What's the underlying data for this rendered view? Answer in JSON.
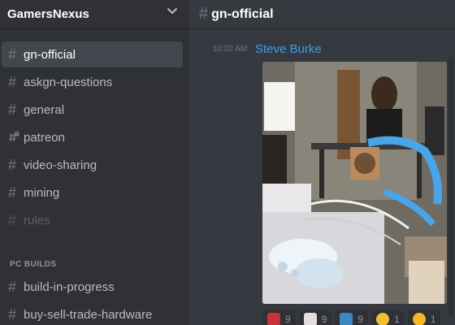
{
  "server": {
    "name": "GamersNexus"
  },
  "channels": [
    {
      "label": "gn-official",
      "state": "active",
      "icon": "hash"
    },
    {
      "label": "askgn-questions",
      "state": "normal",
      "icon": "hash"
    },
    {
      "label": "general",
      "state": "normal",
      "icon": "hash"
    },
    {
      "label": "patreon",
      "state": "normal",
      "icon": "locked-hash"
    },
    {
      "label": "video-sharing",
      "state": "normal",
      "icon": "hash"
    },
    {
      "label": "mining",
      "state": "normal",
      "icon": "hash"
    },
    {
      "label": "rules",
      "state": "muted",
      "icon": "hash"
    }
  ],
  "category": {
    "label": "PC BUILDS"
  },
  "category_channels": [
    {
      "label": "build-in-progress",
      "icon": "hash"
    },
    {
      "label": "buy-sell-trade-hardware",
      "icon": "hash"
    }
  ],
  "main": {
    "channel_title": "gn-official",
    "message": {
      "timestamp": "10:02 AM",
      "author": "Steve Burke",
      "attachment_icon": "image-attachment"
    },
    "reactions": [
      {
        "emoji": "red-emoji",
        "count": "9"
      },
      {
        "emoji": "cat-emoji",
        "count": "9"
      },
      {
        "emoji": "cool-emoji",
        "count": "9"
      },
      {
        "emoji": "thumbs-up-emoji",
        "count": "1"
      },
      {
        "emoji": "heart-eyes-emoji",
        "count": "1"
      }
    ]
  },
  "colors": {
    "accent_link": "#3e9ef0",
    "sidebar": "#2f3136",
    "main": "#36393f",
    "active_channel": "#42464d"
  }
}
